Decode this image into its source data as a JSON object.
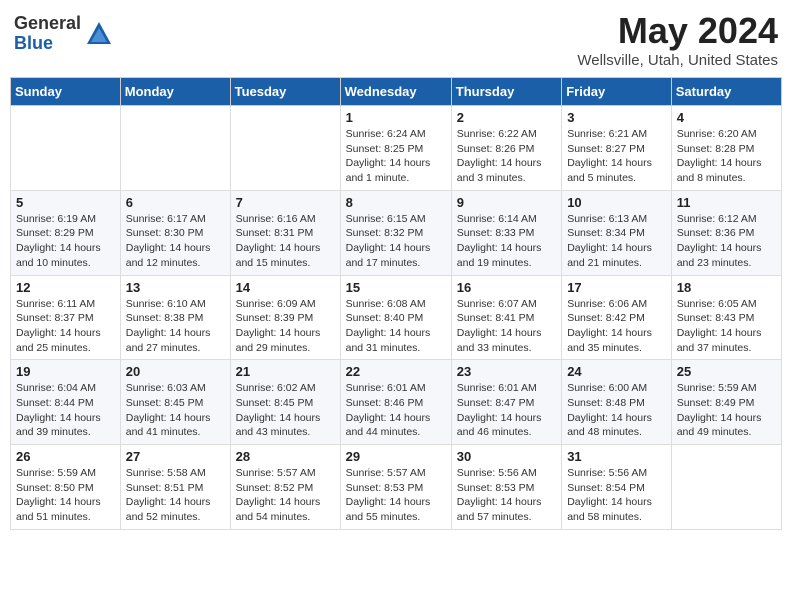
{
  "header": {
    "logo_general": "General",
    "logo_blue": "Blue",
    "title": "May 2024",
    "location": "Wellsville, Utah, United States"
  },
  "weekdays": [
    "Sunday",
    "Monday",
    "Tuesday",
    "Wednesday",
    "Thursday",
    "Friday",
    "Saturday"
  ],
  "weeks": [
    [
      {
        "day": "",
        "sunrise": "",
        "sunset": "",
        "daylight": ""
      },
      {
        "day": "",
        "sunrise": "",
        "sunset": "",
        "daylight": ""
      },
      {
        "day": "",
        "sunrise": "",
        "sunset": "",
        "daylight": ""
      },
      {
        "day": "1",
        "sunrise": "6:24 AM",
        "sunset": "8:25 PM",
        "daylight": "14 hours and 1 minute."
      },
      {
        "day": "2",
        "sunrise": "6:22 AM",
        "sunset": "8:26 PM",
        "daylight": "14 hours and 3 minutes."
      },
      {
        "day": "3",
        "sunrise": "6:21 AM",
        "sunset": "8:27 PM",
        "daylight": "14 hours and 5 minutes."
      },
      {
        "day": "4",
        "sunrise": "6:20 AM",
        "sunset": "8:28 PM",
        "daylight": "14 hours and 8 minutes."
      }
    ],
    [
      {
        "day": "5",
        "sunrise": "6:19 AM",
        "sunset": "8:29 PM",
        "daylight": "14 hours and 10 minutes."
      },
      {
        "day": "6",
        "sunrise": "6:17 AM",
        "sunset": "8:30 PM",
        "daylight": "14 hours and 12 minutes."
      },
      {
        "day": "7",
        "sunrise": "6:16 AM",
        "sunset": "8:31 PM",
        "daylight": "14 hours and 15 minutes."
      },
      {
        "day": "8",
        "sunrise": "6:15 AM",
        "sunset": "8:32 PM",
        "daylight": "14 hours and 17 minutes."
      },
      {
        "day": "9",
        "sunrise": "6:14 AM",
        "sunset": "8:33 PM",
        "daylight": "14 hours and 19 minutes."
      },
      {
        "day": "10",
        "sunrise": "6:13 AM",
        "sunset": "8:34 PM",
        "daylight": "14 hours and 21 minutes."
      },
      {
        "day": "11",
        "sunrise": "6:12 AM",
        "sunset": "8:36 PM",
        "daylight": "14 hours and 23 minutes."
      }
    ],
    [
      {
        "day": "12",
        "sunrise": "6:11 AM",
        "sunset": "8:37 PM",
        "daylight": "14 hours and 25 minutes."
      },
      {
        "day": "13",
        "sunrise": "6:10 AM",
        "sunset": "8:38 PM",
        "daylight": "14 hours and 27 minutes."
      },
      {
        "day": "14",
        "sunrise": "6:09 AM",
        "sunset": "8:39 PM",
        "daylight": "14 hours and 29 minutes."
      },
      {
        "day": "15",
        "sunrise": "6:08 AM",
        "sunset": "8:40 PM",
        "daylight": "14 hours and 31 minutes."
      },
      {
        "day": "16",
        "sunrise": "6:07 AM",
        "sunset": "8:41 PM",
        "daylight": "14 hours and 33 minutes."
      },
      {
        "day": "17",
        "sunrise": "6:06 AM",
        "sunset": "8:42 PM",
        "daylight": "14 hours and 35 minutes."
      },
      {
        "day": "18",
        "sunrise": "6:05 AM",
        "sunset": "8:43 PM",
        "daylight": "14 hours and 37 minutes."
      }
    ],
    [
      {
        "day": "19",
        "sunrise": "6:04 AM",
        "sunset": "8:44 PM",
        "daylight": "14 hours and 39 minutes."
      },
      {
        "day": "20",
        "sunrise": "6:03 AM",
        "sunset": "8:45 PM",
        "daylight": "14 hours and 41 minutes."
      },
      {
        "day": "21",
        "sunrise": "6:02 AM",
        "sunset": "8:45 PM",
        "daylight": "14 hours and 43 minutes."
      },
      {
        "day": "22",
        "sunrise": "6:01 AM",
        "sunset": "8:46 PM",
        "daylight": "14 hours and 44 minutes."
      },
      {
        "day": "23",
        "sunrise": "6:01 AM",
        "sunset": "8:47 PM",
        "daylight": "14 hours and 46 minutes."
      },
      {
        "day": "24",
        "sunrise": "6:00 AM",
        "sunset": "8:48 PM",
        "daylight": "14 hours and 48 minutes."
      },
      {
        "day": "25",
        "sunrise": "5:59 AM",
        "sunset": "8:49 PM",
        "daylight": "14 hours and 49 minutes."
      }
    ],
    [
      {
        "day": "26",
        "sunrise": "5:59 AM",
        "sunset": "8:50 PM",
        "daylight": "14 hours and 51 minutes."
      },
      {
        "day": "27",
        "sunrise": "5:58 AM",
        "sunset": "8:51 PM",
        "daylight": "14 hours and 52 minutes."
      },
      {
        "day": "28",
        "sunrise": "5:57 AM",
        "sunset": "8:52 PM",
        "daylight": "14 hours and 54 minutes."
      },
      {
        "day": "29",
        "sunrise": "5:57 AM",
        "sunset": "8:53 PM",
        "daylight": "14 hours and 55 minutes."
      },
      {
        "day": "30",
        "sunrise": "5:56 AM",
        "sunset": "8:53 PM",
        "daylight": "14 hours and 57 minutes."
      },
      {
        "day": "31",
        "sunrise": "5:56 AM",
        "sunset": "8:54 PM",
        "daylight": "14 hours and 58 minutes."
      },
      {
        "day": "",
        "sunrise": "",
        "sunset": "",
        "daylight": ""
      }
    ]
  ],
  "labels": {
    "sunrise": "Sunrise:",
    "sunset": "Sunset:",
    "daylight": "Daylight:"
  }
}
